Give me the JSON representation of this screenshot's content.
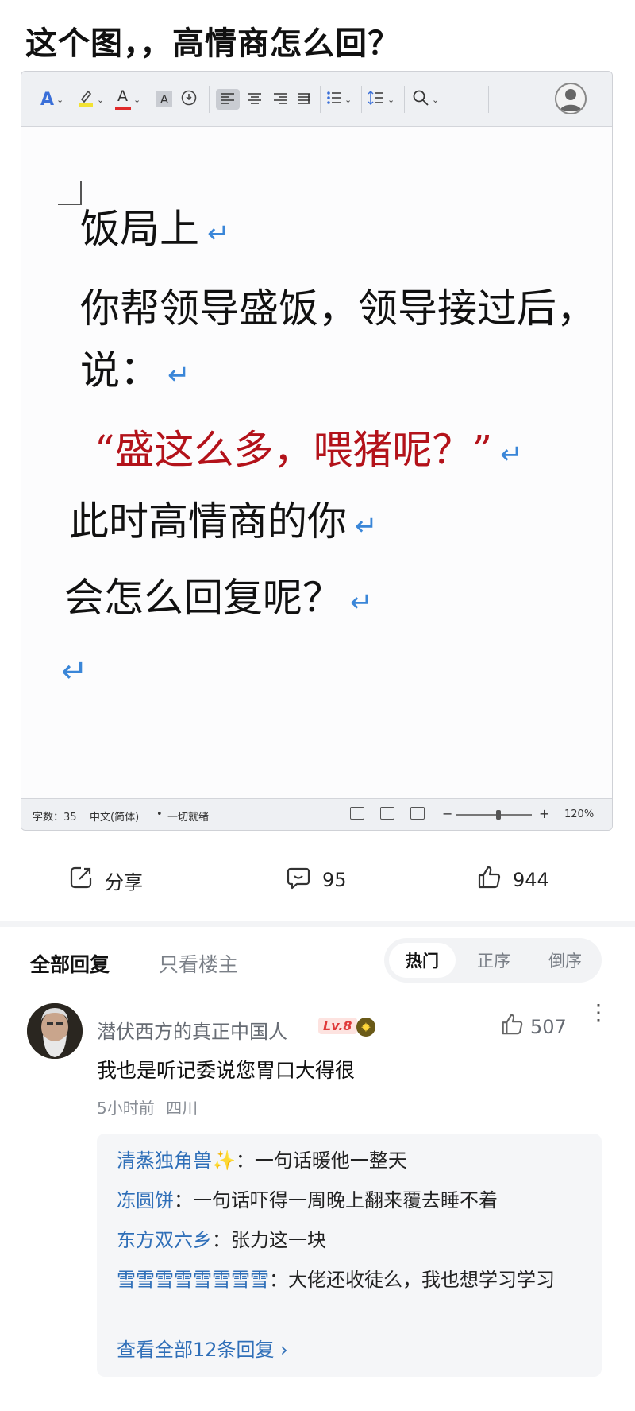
{
  "post": {
    "title": "这个图，，高情商怎么回？"
  },
  "document": {
    "toolbar": {
      "icons": [
        "text-effect-icon",
        "highlight-icon",
        "font-color-icon",
        "char-shading-icon",
        "phonetic-icon",
        "align-left-icon",
        "align-center-icon",
        "align-right-icon",
        "justify-icon",
        "bullet-list-icon",
        "line-spacing-icon",
        "search-icon",
        "account-icon"
      ],
      "font_color_glyph": "A",
      "shading_glyph": "A",
      "caret": "⌄"
    },
    "lines": [
      "饭局上",
      "你帮领导盛饭，领导接过后，",
      "说：",
      "“盛这么多，喂猪呢？”",
      "此时高情商的你",
      "会怎么回复呢？"
    ],
    "paragraph_mark": "↵",
    "colors": {
      "body_text": "#111111",
      "quote_text": "#b3121a",
      "paragraph_mark": "#3a86d8"
    },
    "statusbar": {
      "word_count": "字数：35",
      "language": "中文(简体)",
      "status": "一切就绪",
      "bullet": "•",
      "zoom_minus": "−",
      "zoom_plus": "+",
      "zoom": "120%"
    }
  },
  "actions": {
    "share_label": "分享",
    "comment_count": "95",
    "like_count": "944"
  },
  "replies_section": {
    "tab_all": "全部回复",
    "tab_op_only": "只看楼主",
    "sort": {
      "hot": "热门",
      "asc": "正序",
      "desc": "倒序",
      "active": "hot"
    }
  },
  "comment": {
    "username": "潜伏西方的真正中国人",
    "level": "Lv.8",
    "likes": "507",
    "text": "我也是听记委说您胃口大得很",
    "time": "5小时前",
    "location": "四川",
    "more": "⋮",
    "replies": [
      {
        "user": "清蒸独角兽✨",
        "sep": "：",
        "text": "一句话暖他一整天"
      },
      {
        "user": "冻圆饼",
        "sep": "：",
        "text": "一句话吓得一周晚上翻来覆去睡不着"
      },
      {
        "user": "东方双六乡",
        "sep": "：",
        "text": "张力这一块"
      },
      {
        "user": "雪雪雪雪雪雪雪雪",
        "sep": "：",
        "text": "大佬还收徒么，我也想学习学习"
      }
    ],
    "view_all": "查看全部12条回复 ›"
  }
}
